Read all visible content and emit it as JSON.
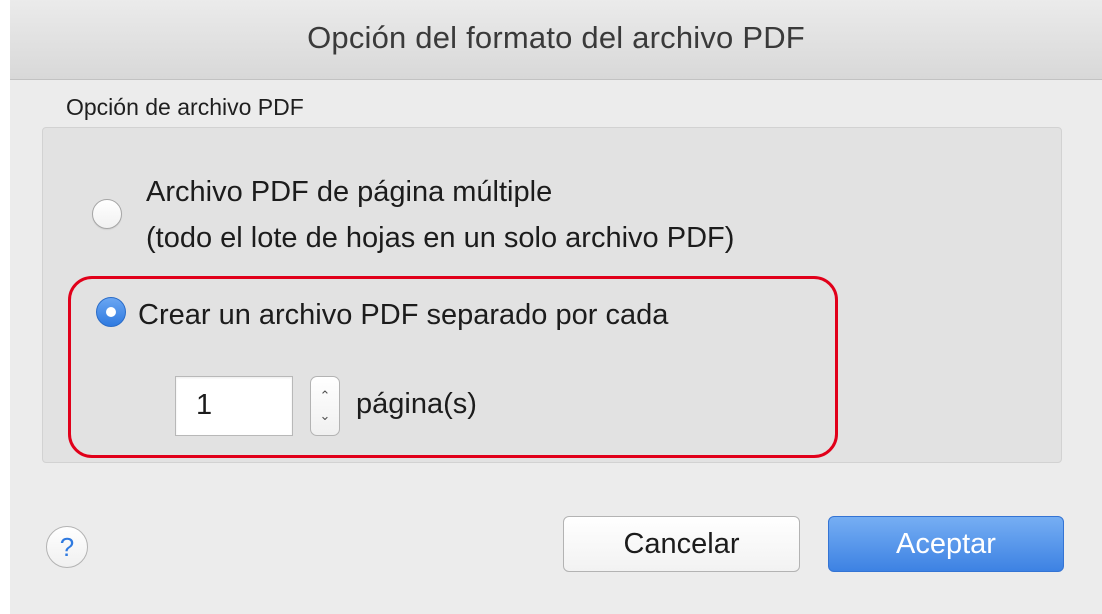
{
  "window": {
    "title": "Opción del formato del archivo PDF"
  },
  "group": {
    "label": "Opción de archivo PDF"
  },
  "options": [
    {
      "line1": "Archivo PDF de página múltiple",
      "line2": "(todo el lote de hojas en un solo archivo PDF)",
      "selected": false
    },
    {
      "line1": "Crear un archivo PDF separado por cada",
      "selected": true
    }
  ],
  "pages": {
    "value": "1",
    "unit_label": "página(s)",
    "stepper_up_glyph": "⌃",
    "stepper_down_glyph": "⌄"
  },
  "footer": {
    "help_glyph": "?",
    "cancel_label": "Cancelar",
    "ok_label": "Aceptar"
  },
  "colors": {
    "accent": "#2f7ae0",
    "highlight": "#e1001a"
  }
}
